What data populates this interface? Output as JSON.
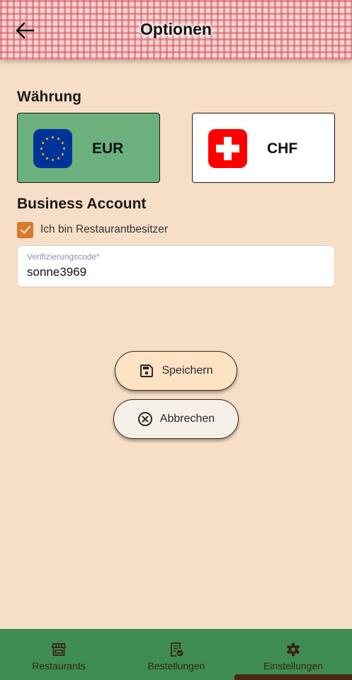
{
  "header": {
    "title": "Optionen",
    "back_icon": "arrow-left-icon"
  },
  "currency": {
    "section_title": "Währung",
    "options": [
      {
        "code": "EUR",
        "flag": "eu-flag-icon",
        "selected": true,
        "color": "#6bb07d"
      },
      {
        "code": "CHF",
        "flag": "swiss-flag-icon",
        "selected": false,
        "color": "#ffffff"
      }
    ]
  },
  "business": {
    "section_title": "Business Account",
    "checkbox_label": "Ich bin Restaurantbesitzer",
    "checked": true,
    "code_label": "Verifizierungscode*",
    "code_value": "sonne3969"
  },
  "actions": {
    "save_label": "Speichern",
    "save_icon": "floppy-disk-icon",
    "cancel_label": "Abbrechen",
    "cancel_icon": "x-circle-icon"
  },
  "nav": {
    "items": [
      {
        "label": "Restaurants",
        "icon": "storefront-icon"
      },
      {
        "label": "Bestellungen",
        "icon": "order-list-icon"
      },
      {
        "label": "Einstellungen",
        "icon": "gear-icon",
        "active": true
      }
    ]
  },
  "colors": {
    "background": "#f7dfc7",
    "accent": "#d97a2b",
    "nav": "#3f8c55",
    "selected_card": "#6bb07d"
  }
}
